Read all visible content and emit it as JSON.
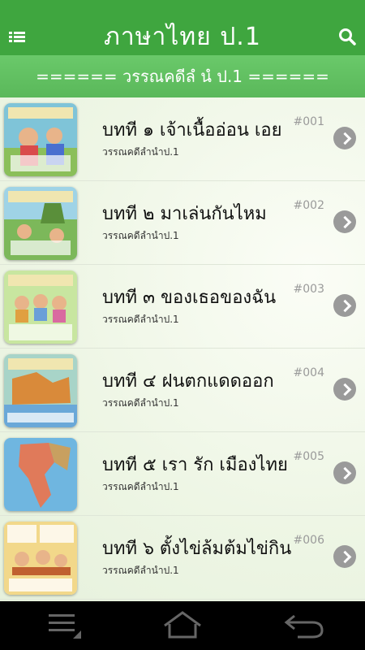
{
  "app": {
    "title": "ภาษาไทย  ป.1",
    "subheader": "======  วรรณคดีลํ นํ   ป.1  ======"
  },
  "lessons": [
    {
      "title": "บทที  ๑  เจ้าเนื้ออ่อน  เอย",
      "subtitle": "วรรณคดีลํานําป.1",
      "number": "#001"
    },
    {
      "title": "บทที  ๒  มาเล่นกันไหม",
      "subtitle": "วรรณคดีลํานําป.1",
      "number": "#002"
    },
    {
      "title": "บทที  ๓  ของเธอของฉัน",
      "subtitle": "วรรณคดีลํานําป.1",
      "number": "#003"
    },
    {
      "title": "บทที  ๔  ฝนตกแดดออก",
      "subtitle": "วรรณคดีลํานําป.1",
      "number": "#004"
    },
    {
      "title": "บทที  ๕  เรา  รัก  เมืองไทย",
      "subtitle": "วรรณคดีลํานําป.1",
      "number": "#005"
    },
    {
      "title": "บทที  ๖  ตั้งไข่ล้มต้มไข่กิน",
      "subtitle": "วรรณคดีลํานําป.1",
      "number": "#006"
    }
  ],
  "colors": {
    "appbar": "#3fa63f",
    "subheader": "#5ab85a",
    "chevron": "#9a9a9a",
    "navbar": "#000000"
  },
  "icons": {
    "menu": "list-menu-icon",
    "search": "search-icon",
    "row_chevron": "chevron-right-icon",
    "recent": "recent-apps-icon",
    "home": "home-icon",
    "back": "back-icon"
  }
}
